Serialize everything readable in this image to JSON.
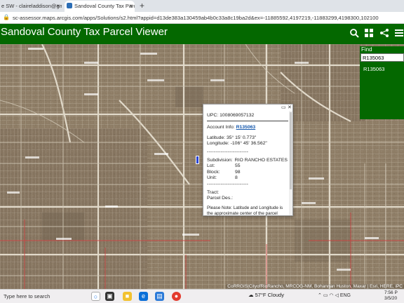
{
  "browser": {
    "tabs": [
      {
        "label": "e SW - claireladdison@gm"
      },
      {
        "label": "Sandoval County Tax Parcel View"
      }
    ],
    "new_tab": "+",
    "url": "sc-assessor.maps.arcgis.com/apps/Solutions/s2.html?appid=d13de383a130459ab4b0c33a8c19ba2d&ex=-11885592,4197219,-11883299,4198300,102100"
  },
  "app": {
    "title": "Sandoval County Tax Parcel Viewer",
    "header_color": "#046800"
  },
  "find": {
    "label": "Find",
    "value": "R135063",
    "result": "R135063"
  },
  "popup": {
    "upc": "UPC: 1008069057132",
    "account_label": "Account Info:",
    "account_value": "R135063",
    "latitude": "Latitude: 35° 15' 0.773\"",
    "longitude": "Longitude: -106° 45' 36.562\"",
    "dashes1": "------------------------",
    "subdivision_label": "Subdivision:",
    "subdivision_value": "RIO RANCHO ESTATES",
    "lot_label": "Lot:",
    "lot_value": "55",
    "block_label": "Block:",
    "block_value": "98",
    "unit_label": "Unit:",
    "unit_value": "8",
    "dashes2": "------------------------",
    "tract": "Tract:",
    "parcel_des": "Parcel Des.:",
    "note": "Please Note: Latitude and Longitude is the approximate center of the parcel shown."
  },
  "map": {
    "attribution": "CoRRGIS|CityofRioRancho, MRCOG-NM, Bohannan Huston, Maxar | Esri, HERE, iPC"
  },
  "taskbar": {
    "search_placeholder": "Type here to search",
    "weather_temp": "57°F",
    "weather_text": "Cloudy",
    "lang": "ENG",
    "time": "7:56 P",
    "date": "3/5/20"
  }
}
